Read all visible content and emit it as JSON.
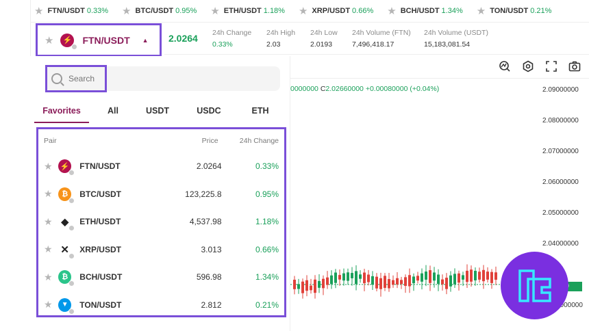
{
  "ticker": [
    {
      "symbol": "FTN/USDT",
      "change": "0.33%"
    },
    {
      "symbol": "BTC/USDT",
      "change": "0.95%"
    },
    {
      "symbol": "ETH/USDT",
      "change": "1.18%"
    },
    {
      "symbol": "XRP/USDT",
      "change": "0.66%"
    },
    {
      "symbol": "BCH/USDT",
      "change": "1.34%"
    },
    {
      "symbol": "TON/USDT",
      "change": "0.21%"
    }
  ],
  "header": {
    "pair": "FTN/USDT",
    "price": "2.0264",
    "stats": [
      {
        "label": "24h Change",
        "value": "0.33%"
      },
      {
        "label": "24h High",
        "value": "2.03"
      },
      {
        "label": "24h Low",
        "value": "2.0193"
      },
      {
        "label": "24h Volume (FTN)",
        "value": "7,496,418.17"
      },
      {
        "label": "24h Volume (USDT)",
        "value": "15,183,081.54"
      }
    ]
  },
  "search": {
    "placeholder": "Search"
  },
  "tabs": [
    "Favorites",
    "All",
    "USDT",
    "USDC",
    "ETH"
  ],
  "list": {
    "columns": {
      "pair": "Pair",
      "price": "Price",
      "change": "24h Change"
    },
    "rows": [
      {
        "pair": "FTN/USDT",
        "price": "2.0264",
        "change": "0.33%",
        "icon": "ftn-coin-icon",
        "color": "#b3124f"
      },
      {
        "pair": "BTC/USDT",
        "price": "123,225.8",
        "change": "0.95%",
        "icon": "btc-coin-icon",
        "color": "#f7931a"
      },
      {
        "pair": "ETH/USDT",
        "price": "4,537.98",
        "change": "1.18%",
        "icon": "eth-coin-icon",
        "color": "#222222"
      },
      {
        "pair": "XRP/USDT",
        "price": "3.013",
        "change": "0.66%",
        "icon": "xrp-coin-icon",
        "color": "#222222"
      },
      {
        "pair": "BCH/USDT",
        "price": "596.98",
        "change": "1.34%",
        "icon": "bch-coin-icon",
        "color": "#2bc48a"
      },
      {
        "pair": "TON/USDT",
        "price": "2.812",
        "change": "0.21%",
        "icon": "ton-coin-icon",
        "color": "#0098ea"
      }
    ]
  },
  "chart": {
    "ohlc_open_fragment": "0000000",
    "close_label": "C",
    "close_value": "2.02660000",
    "change": "+0.00080000 (+0.04%)",
    "y_axis_labels": [
      "2.09000000",
      "2.08000000",
      "2.07000000",
      "2.06000000",
      "2.05000000",
      "2.04000000"
    ],
    "y_axis_bottom_fragment": "2000000",
    "last_price_fragment": "000"
  },
  "colors": {
    "accent": "#8b1d5a",
    "up": "#1aa05a",
    "down": "#e0413a",
    "highlight": "#7a4fd8"
  }
}
